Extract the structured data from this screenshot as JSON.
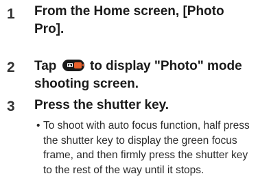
{
  "steps": [
    {
      "number": "1",
      "text": "From the Home screen, [Photo Pro]."
    },
    {
      "number": "2",
      "text_before": "Tap",
      "icon": "photo-video-mode-toggle-icon",
      "text_after": "to display \"Photo\" mode shooting screen."
    },
    {
      "number": "3",
      "text": "Press the shutter key.",
      "bullet_marker": "•",
      "bullet": "To shoot with auto focus function, half press the shutter key to display the green focus frame, and then firmly press the shutter key to the rest of the way until it stops."
    }
  ],
  "colors": {
    "toggle_body": "#1a1a1a",
    "video_accent": "#e8612c"
  }
}
